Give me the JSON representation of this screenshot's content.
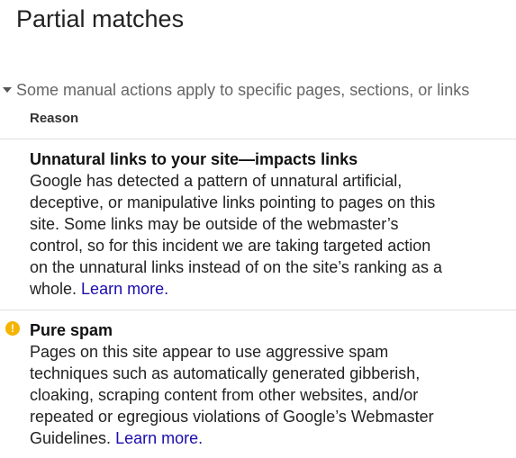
{
  "page": {
    "title": "Partial matches"
  },
  "section": {
    "toggle_label": "Some manual actions apply to specific pages, sections, or links",
    "column_header": "Reason"
  },
  "actions": [
    {
      "title": "Unnatural links to your site—impacts links",
      "description": "Google has detected a pattern of unnatural artificial, deceptive, or manipulative links pointing to pages on this site. Some links may be outside of the webmaster’s control, so for this incident we are taking targeted action on the unnatural links instead of on the site’s ranking as a whole.",
      "link_text": "Learn more.",
      "icon": ""
    },
    {
      "title": "Pure spam",
      "description": "Pages on this site appear to use aggressive spam techniques such as automatically generated gibberish, cloaking, scraping content from other websites, and/or repeated or egregious violations of Google’s Webmaster Guidelines.",
      "link_text": "Learn more.",
      "icon": "warning-icon"
    }
  ],
  "colors": {
    "link": "#1a0dab",
    "warning": "#f4b400",
    "muted_text": "#666666"
  }
}
